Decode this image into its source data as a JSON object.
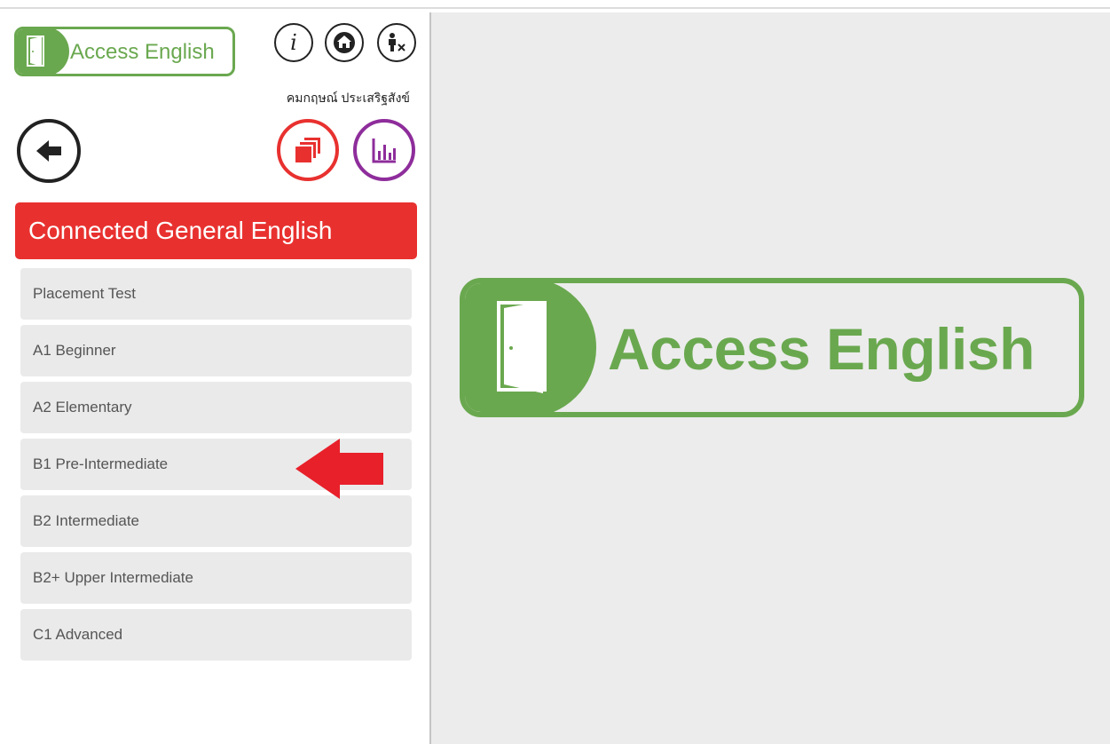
{
  "app": {
    "logo_text": "Access English",
    "brand_color": "#6aa84f",
    "accent_color": "#e8312f",
    "stats_color": "#8e2d9b"
  },
  "header": {
    "icons": [
      "info-icon",
      "home-icon",
      "logout-icon"
    ],
    "info_glyph": "i",
    "user_name": "คมกฤษณ์ ประเสริฐสังข์"
  },
  "actions": {
    "back": "arrow-left-icon",
    "courses": "stacked-pages-icon",
    "stats": "bar-chart-icon"
  },
  "course": {
    "title": "Connected General English",
    "levels": [
      "Placement Test",
      "A1 Beginner",
      "A2 Elementary",
      "B1 Pre-Intermediate",
      "B2 Intermediate",
      "B2+ Upper Intermediate",
      "C1 Advanced"
    ]
  },
  "annotation": {
    "pointer": "red-arrow-icon",
    "target_level": "B1 Pre-Intermediate"
  },
  "main": {
    "logo_text": "Access English"
  }
}
